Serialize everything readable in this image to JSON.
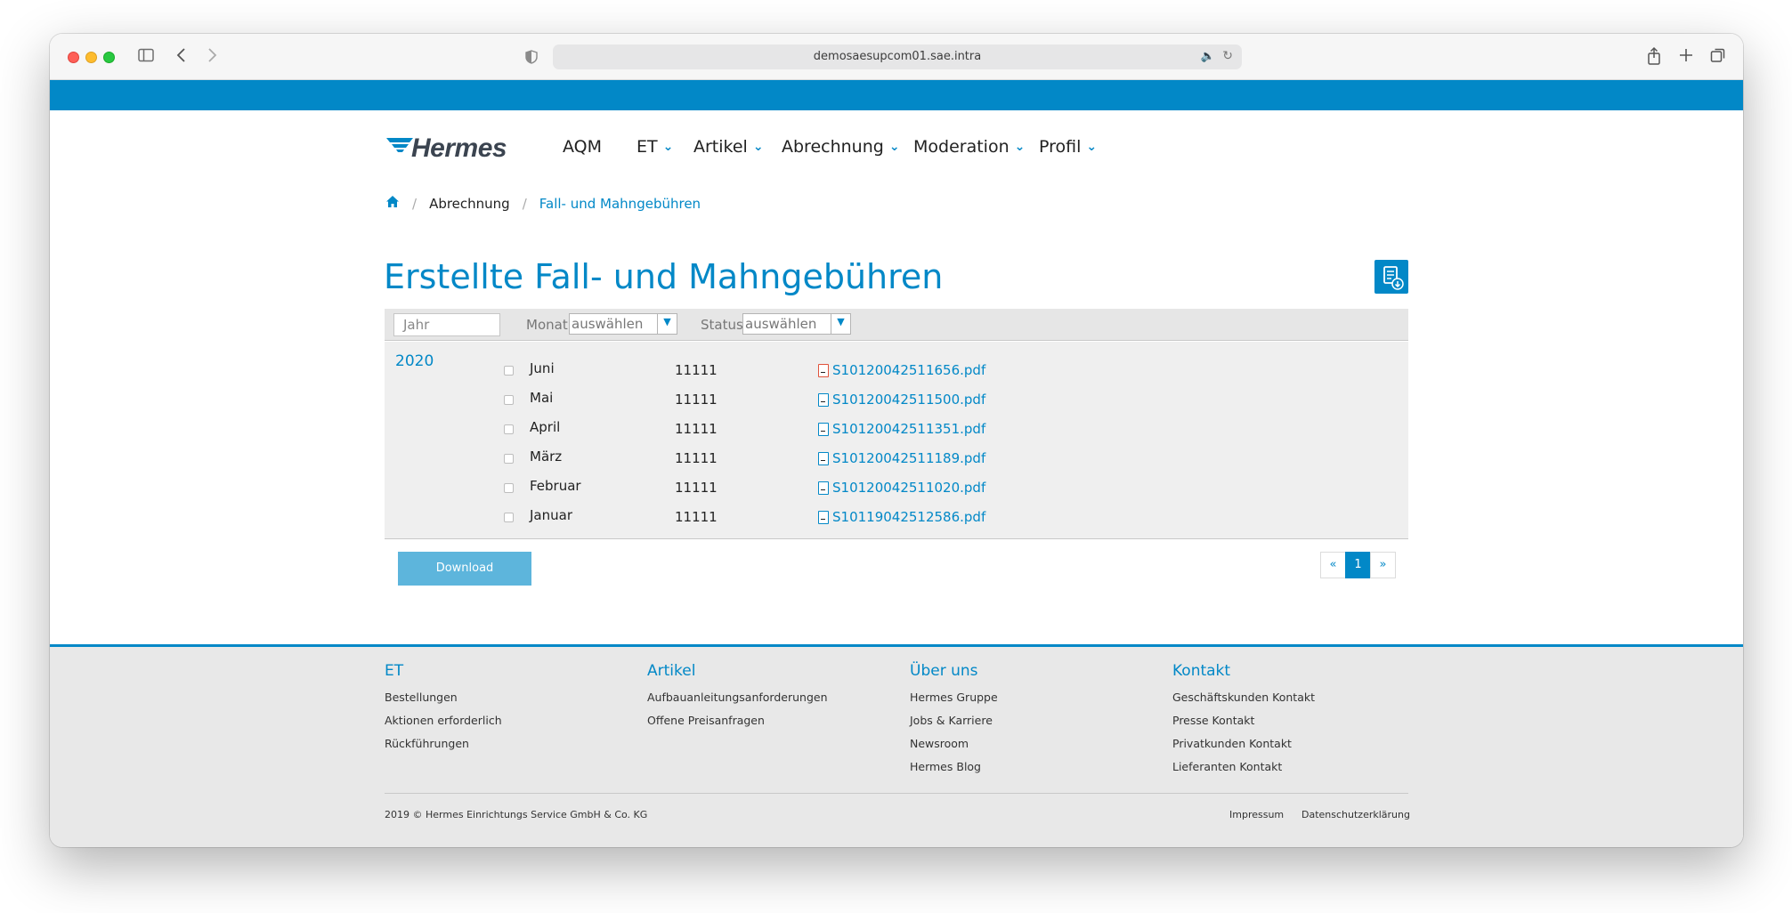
{
  "browser": {
    "url": "demosaesupcom01.sae.intra"
  },
  "header": {
    "logo_text": "Hermes",
    "nav": [
      {
        "label": "AQM",
        "dropdown": false
      },
      {
        "label": "ET",
        "dropdown": true
      },
      {
        "label": "Artikel",
        "dropdown": true
      },
      {
        "label": "Abrechnung",
        "dropdown": true
      },
      {
        "label": "Moderation",
        "dropdown": true
      },
      {
        "label": "Profil",
        "dropdown": true
      }
    ]
  },
  "breadcrumb": {
    "items": [
      "Abrechnung",
      "Fall- und Mahngebühren"
    ]
  },
  "page": {
    "title": "Erstellte Fall- und Mahngebühren"
  },
  "filters": {
    "year_placeholder": "Jahr",
    "month_label": "Monat",
    "month_value": "auswählen",
    "status_label": "Status",
    "status_value": "auswählen"
  },
  "results": {
    "year": "2020",
    "rows": [
      {
        "month": "Juni",
        "number": "11111",
        "file": "S10120042511656.pdf",
        "icon_color": "#e0533c"
      },
      {
        "month": "Mai",
        "number": "11111",
        "file": "S10120042511500.pdf",
        "icon_color": "#0288c7"
      },
      {
        "month": "April",
        "number": "11111",
        "file": "S10120042511351.pdf",
        "icon_color": "#0288c7"
      },
      {
        "month": "März",
        "number": "11111",
        "file": "S10120042511189.pdf",
        "icon_color": "#0288c7"
      },
      {
        "month": "Februar",
        "number": "11111",
        "file": "S10120042511020.pdf",
        "icon_color": "#0288c7"
      },
      {
        "month": "Januar",
        "number": "11111",
        "file": "S10119042512586.pdf",
        "icon_color": "#0288c7"
      }
    ]
  },
  "actions": {
    "download_label": "Download"
  },
  "pagination": {
    "prev": "«",
    "current": "1",
    "next": "»"
  },
  "footer": {
    "columns": [
      {
        "title": "ET",
        "links": [
          "Bestellungen",
          "Aktionen erforderlich",
          "Rückführungen"
        ]
      },
      {
        "title": "Artikel",
        "links": [
          "Aufbauanleitungsanforderungen",
          "Offene Preisanfragen"
        ]
      },
      {
        "title": "Über uns",
        "links": [
          "Hermes Gruppe",
          "Jobs & Karriere",
          "Newsroom",
          "Hermes Blog"
        ]
      },
      {
        "title": "Kontakt",
        "links": [
          "Geschäftskunden Kontakt",
          "Presse Kontakt",
          "Privatkunden Kontakt",
          "Lieferanten Kontakt"
        ]
      }
    ],
    "copyright": "2019 © Hermes Einrichtungs Service GmbH & Co. KG",
    "impressum": "Impressum",
    "datenschutz": "Datenschutzerklärung"
  },
  "colors": {
    "brand_blue": "#0288c7",
    "button_blue": "#5db5dc"
  }
}
